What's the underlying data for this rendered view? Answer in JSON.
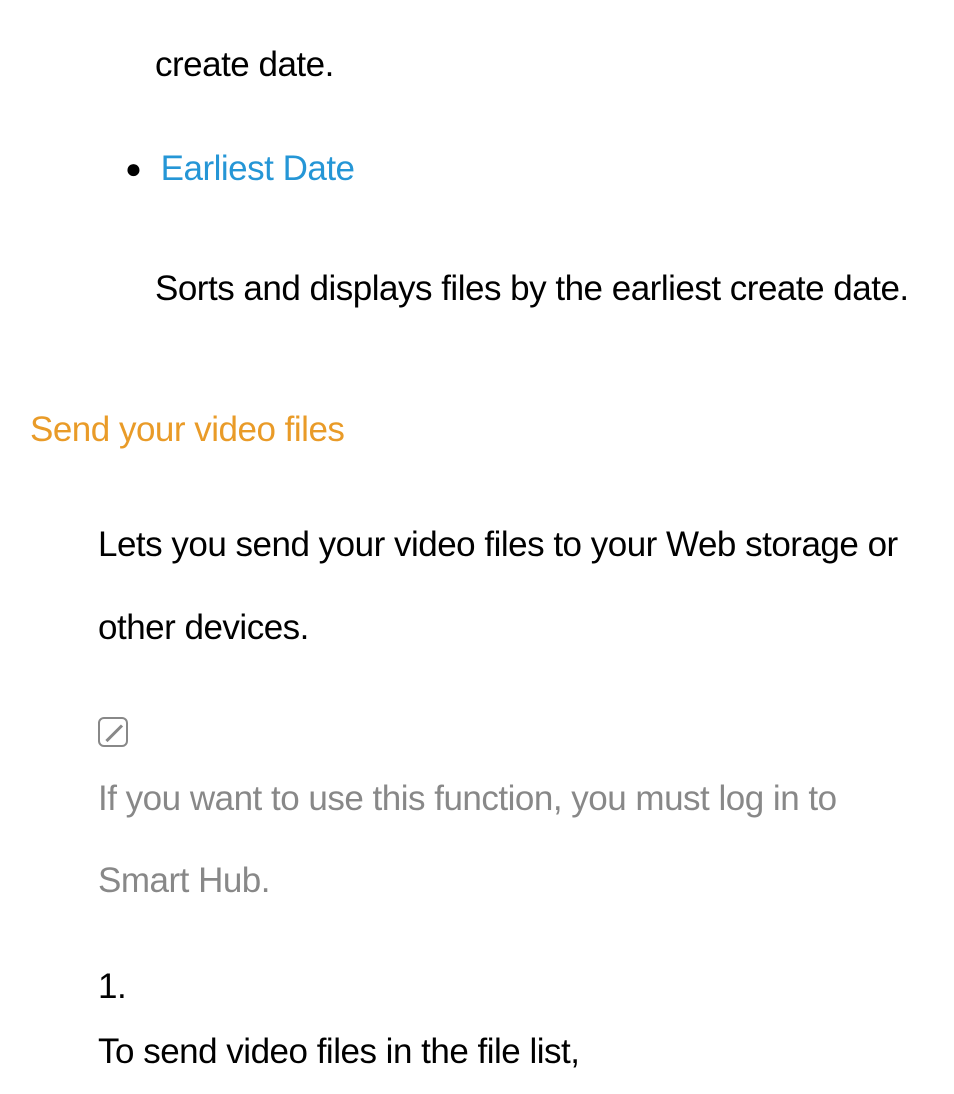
{
  "fragment_top": "create date.",
  "earliest_date": {
    "title": "Earliest Date",
    "description": "Sorts and displays files by the earliest create date."
  },
  "section": {
    "title": "Send your video files",
    "intro": "Lets you send your video files to your Web storage or other devices.",
    "note": "If you want to use this function, you must log in to Smart Hub.",
    "steps": [
      {
        "number": "1.",
        "text": "To send video files in the file list,"
      }
    ]
  }
}
